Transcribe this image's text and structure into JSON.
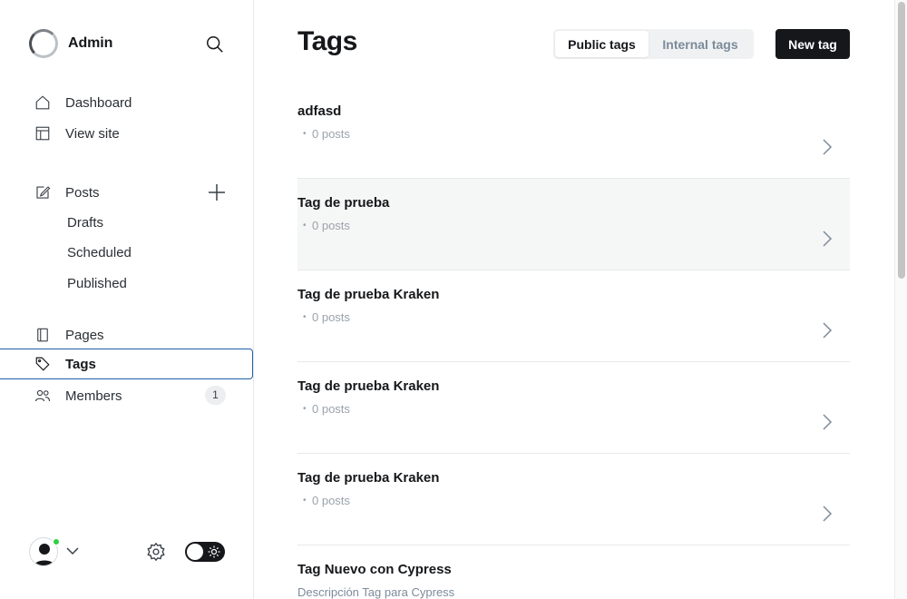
{
  "brand": {
    "name": "Admin"
  },
  "nav": {
    "dashboard": "Dashboard",
    "view_site": "View site",
    "posts": "Posts",
    "drafts": "Drafts",
    "scheduled": "Scheduled",
    "published": "Published",
    "pages": "Pages",
    "tags": "Tags",
    "members": "Members",
    "members_count": "1"
  },
  "header": {
    "title": "Tags",
    "public_tab": "Public tags",
    "internal_tab": "Internal tags",
    "new_tag": "New tag"
  },
  "tags": [
    {
      "name": "adfasd",
      "meta": "0 posts"
    },
    {
      "name": "Tag de prueba",
      "meta": "0 posts"
    },
    {
      "name": "Tag de prueba Kraken",
      "meta": "0 posts"
    },
    {
      "name": "Tag de prueba Kraken",
      "meta": "0 posts"
    },
    {
      "name": "Tag de prueba Kraken",
      "meta": "0 posts"
    },
    {
      "name": "Tag Nuevo con Cypress",
      "description": "Descripción Tag para Cypress"
    }
  ],
  "colors": {
    "accent": "#15171a",
    "active_border": "#1f5ea8",
    "online": "#30cf43"
  },
  "icons": [
    "search-icon",
    "home-icon",
    "layout-icon",
    "edit-icon",
    "plus-icon",
    "page-icon",
    "tag-icon",
    "members-icon",
    "gear-icon",
    "sun-icon",
    "chevron-right-icon",
    "chevron-down-icon"
  ]
}
